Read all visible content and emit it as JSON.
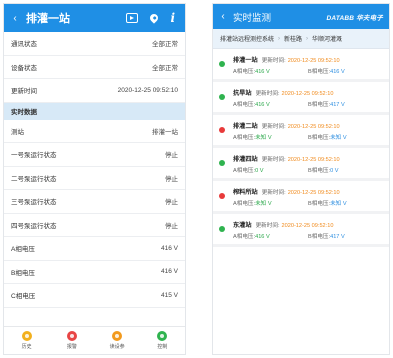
{
  "left": {
    "title": "排灌一站",
    "status_rows": [
      {
        "label": "通讯状态",
        "value": "全部正常"
      },
      {
        "label": "设备状态",
        "value": "全部正常"
      },
      {
        "label": "更新时间",
        "value": "2020-12-25 09:52:10"
      }
    ],
    "section_label": "实时数据",
    "data_rows": [
      {
        "label": "测站",
        "value": "排灌一站"
      },
      {
        "label": "一号泵运行状态",
        "value": "停止"
      },
      {
        "label": "二号泵运行状态",
        "value": "停止"
      },
      {
        "label": "三号泵运行状态",
        "value": "停止"
      },
      {
        "label": "四号泵运行状态",
        "value": "停止"
      },
      {
        "label": "A相电压",
        "value": "416 V"
      },
      {
        "label": "B相电压",
        "value": "416 V"
      },
      {
        "label": "C相电压",
        "value": "415 V"
      }
    ],
    "nav": [
      {
        "label": "历史",
        "color": "#f2b01e"
      },
      {
        "label": "报警",
        "color": "#e84545"
      },
      {
        "label": "读设参",
        "color": "#f29a1e"
      },
      {
        "label": "控制",
        "color": "#2fb34f"
      }
    ]
  },
  "right": {
    "title": "实时监测",
    "brand": "DATABB 华夫电子",
    "breadcrumb": [
      "排灌站远程测控系统",
      "新桂路",
      "华顺河灌溉"
    ],
    "label_update": "更新时间:",
    "label_a": "A相电压:",
    "label_b": "B相电压:",
    "stations": [
      {
        "name": "排灌一站",
        "time": "2020-12-25 09:52:10",
        "a": "416 V",
        "b": "416 V",
        "dot": "#2fb34f",
        "a_class": "green",
        "b_class": "blue"
      },
      {
        "name": "抗旱站",
        "time": "2020-12-25 09:52:10",
        "a": "416 V",
        "b": "417 V",
        "dot": "#2fb34f",
        "a_class": "green",
        "b_class": "blue"
      },
      {
        "name": "排灌二站",
        "time": "2020-12-25 09:52:10",
        "a": "未知 V",
        "b": "未知 V",
        "dot": "#e83a3a",
        "a_class": "green",
        "b_class": "blue"
      },
      {
        "name": "排灌四站",
        "time": "2020-12-25 09:52:10",
        "a": "0 V",
        "b": "0 V",
        "dot": "#2fb34f",
        "a_class": "green",
        "b_class": "blue"
      },
      {
        "name": "榨料所站",
        "time": "2020-12-25 09:52:10",
        "a": "未知 V",
        "b": "未知 V",
        "dot": "#e83a3a",
        "a_class": "green",
        "b_class": "blue"
      },
      {
        "name": "东灌站",
        "time": "2020-12-25 09:52:10",
        "a": "416 V",
        "b": "417 V",
        "dot": "#2fb34f",
        "a_class": "green",
        "b_class": "blue"
      }
    ]
  }
}
